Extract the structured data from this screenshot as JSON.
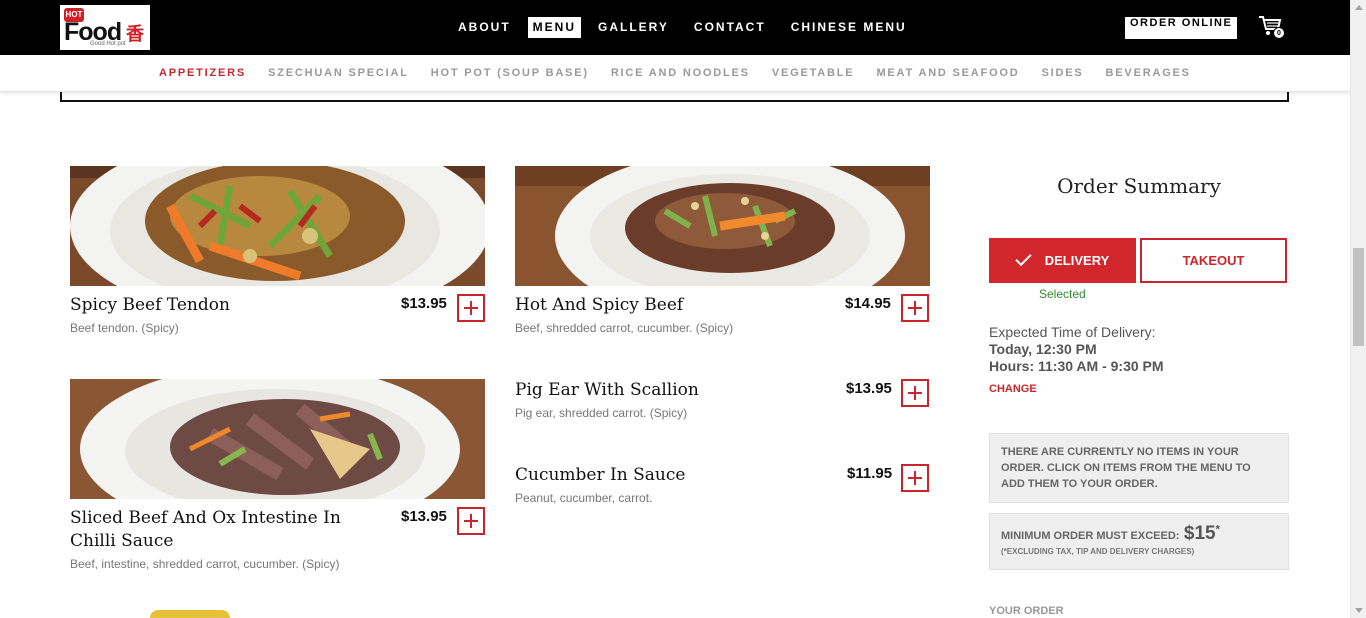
{
  "brand": {
    "logo_badge": "HOT",
    "logo_text": "Food",
    "logo_cn": "香锅",
    "logo_tagline": "Good Hot pot"
  },
  "nav": {
    "items": [
      "ABOUT",
      "MENU",
      "GALLERY",
      "CONTACT",
      "CHINESE MENU"
    ],
    "active": "MENU"
  },
  "header": {
    "order_online": "ORDER ONLINE",
    "cart_count": "0"
  },
  "categories": {
    "items": [
      "APPETIZERS",
      "SZECHUAN SPECIAL",
      "HOT POT (SOUP BASE)",
      "RICE AND NOODLES",
      "VEGETABLE",
      "MEAT AND SEAFOOD",
      "SIDES",
      "BEVERAGES"
    ],
    "active": "APPETIZERS"
  },
  "menu": {
    "items": [
      {
        "name": "Spicy Beef Tendon",
        "desc": "Beef tendon. (Spicy)",
        "price": "$13.95"
      },
      {
        "name": "Hot And Spicy Beef",
        "desc": "Beef, shredded carrot, cucumber. (Spicy)",
        "price": "$14.95"
      },
      {
        "name": "Sliced Beef And Ox Intestine In Chilli Sauce",
        "desc": "Beef, intestine, shredded carrot, cucumber. (Spicy)",
        "price": "$13.95"
      },
      {
        "name": "Pig Ear With Scallion",
        "desc": "Pig ear, shredded carrot. (Spicy)",
        "price": "$13.95"
      },
      {
        "name": "Cucumber In Sauce",
        "desc": "Peanut, cucumber, carrot.",
        "price": "$11.95"
      }
    ]
  },
  "summary": {
    "title": "Order Summary",
    "delivery_label": "DELIVERY",
    "takeout_label": "TAKEOUT",
    "selected_label": "Selected",
    "expected_label": "Expected Time of Delivery:",
    "today": "Today, 12:30 PM",
    "hours": "Hours: 11:30 AM - 9:30 PM",
    "change": "CHANGE",
    "empty_message": "THERE ARE CURRENTLY NO ITEMS IN YOUR ORDER. CLICK ON ITEMS FROM THE MENU TO ADD THEM TO YOUR ORDER.",
    "minimum_label": "MINIMUM ORDER MUST EXCEED:",
    "minimum_amount": "$15",
    "minimum_mark": "*",
    "minimum_note": "(*EXCLUDING TAX, TIP AND DELIVERY CHARGES)",
    "your_order": "YOUR ORDER"
  },
  "colors": {
    "accent": "#c8262c",
    "selected": "#2e8b2e",
    "topbar": "#000000"
  }
}
